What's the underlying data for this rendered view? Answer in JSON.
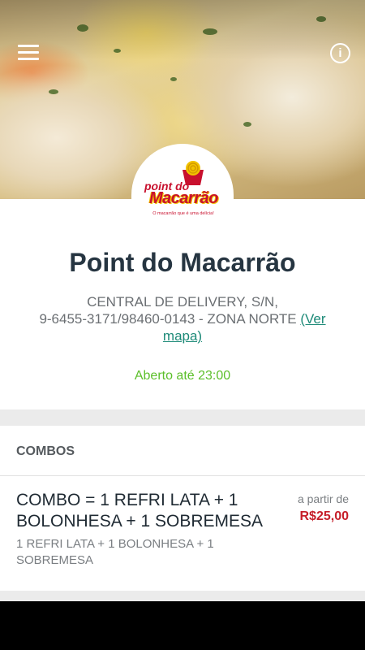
{
  "header": {
    "menu_icon": "hamburger-menu-icon",
    "info_icon": "info-icon",
    "info_glyph": "i"
  },
  "logo": {
    "line1": "point do",
    "line2": "Macarrão",
    "slogan": "O macarrão que é uma delícia!"
  },
  "restaurant": {
    "name": "Point do Macarrão",
    "address_line1": "CENTRAL DE DELIVERY, S/N,",
    "address_line2": "9-6455-3171/98460-0143 - ZONA NORTE",
    "map_link": "(Ver mapa)",
    "status": "Aberto até 23:00"
  },
  "section": {
    "title": "COMBOS"
  },
  "items": [
    {
      "name": "COMBO = 1 REFRI LATA + 1 BOLONHESA + 1 SOBREMESA",
      "description": "1 REFRI LATA + 1 BOLONHESA + 1 SOBREMESA",
      "price_label": "a partir de",
      "price": "R$25,00"
    }
  ],
  "colors": {
    "title": "#263541",
    "status_open": "#5cbf2a",
    "link": "#1d8a78",
    "price": "#c61f2a",
    "brand_red": "#c8102e",
    "brand_yellow": "#f2c200"
  }
}
